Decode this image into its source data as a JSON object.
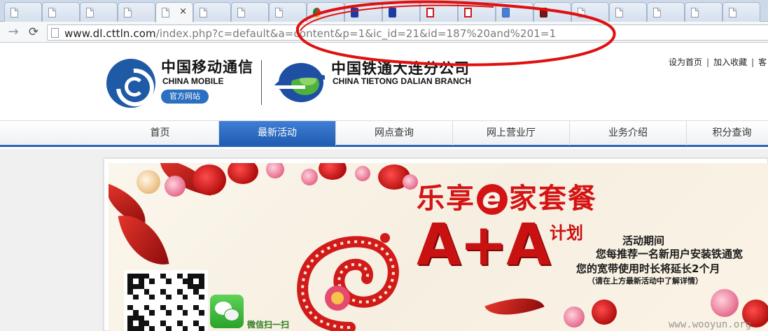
{
  "browser": {
    "tabs": [
      {
        "icon": "page-icon"
      },
      {
        "icon": "page-icon"
      },
      {
        "icon": "page-icon"
      },
      {
        "icon": "page-icon"
      },
      {
        "icon": "page-icon",
        "active": true,
        "close_glyph": "×"
      },
      {
        "icon": "page-icon"
      },
      {
        "icon": "page-icon"
      },
      {
        "icon": "page-icon"
      },
      {
        "icon": "chrome-icon"
      },
      {
        "icon": "paw-icon"
      },
      {
        "icon": "paw-icon"
      },
      {
        "icon": "red-e-icon"
      },
      {
        "icon": "red-e-icon"
      },
      {
        "icon": "google-icon"
      },
      {
        "icon": "dark-icon"
      },
      {
        "icon": "page-icon"
      },
      {
        "icon": "page-icon"
      },
      {
        "icon": "page-icon"
      },
      {
        "icon": "page-icon"
      },
      {
        "icon": "page-icon"
      }
    ],
    "url_host": "www.dl.cttln.com",
    "url_rest": "/index.php?c=default&a=content&p=1&ic_id=21&id=187%20and%201=1",
    "annotation_color": "#e01010"
  },
  "header": {
    "china_mobile_cn": "中国移动通信",
    "china_mobile_en": "CHINA MOBILE",
    "official_badge": "官方网站",
    "tietong_cn": "中国铁通大连分公司",
    "tietong_en": "CHINA TIETONG DALIAN BRANCH",
    "top_links": [
      "设为首页",
      "加入收藏",
      "客"
    ]
  },
  "nav": {
    "items": [
      {
        "label": "首页"
      },
      {
        "label": "最新活动",
        "active": true
      },
      {
        "label": "网点查询"
      },
      {
        "label": "网上营业厅"
      },
      {
        "label": "业务介绍"
      },
      {
        "label": "积分查询"
      }
    ],
    "accent": "#2c63b6"
  },
  "banner": {
    "headline_before": "乐享",
    "headline_e": "e",
    "headline_after": "家套餐",
    "aa": "A+A",
    "plan": "计划",
    "period": "活动期间",
    "line1": "您每推荐一名新用户安装铁通宽",
    "line2": "您的宽带使用时长将延长2个月",
    "note": "（请在上方最新活动中了解详情）",
    "wechat_label": "微信扫一扫",
    "main_color": "#d41414"
  },
  "watermark": "www.wooyun.org"
}
